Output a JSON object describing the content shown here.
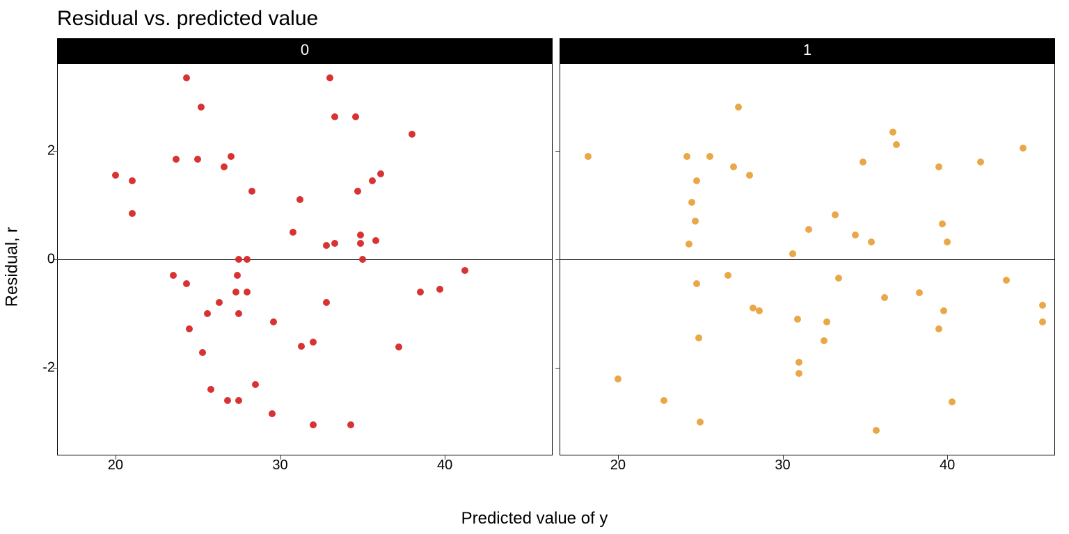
{
  "chart_data": {
    "type": "scatter",
    "title": "Residual vs. predicted value",
    "xlabel": "Predicted value of y",
    "ylabel": "Residual, r",
    "xlim": [
      16.5,
      46.5
    ],
    "ylim": [
      -3.6,
      3.6
    ],
    "x_ticks": [
      20,
      30,
      40
    ],
    "y_ticks": [
      -2,
      0,
      2
    ],
    "facets": [
      {
        "label": "0",
        "color": "#D62728",
        "reference_line": 0,
        "points": [
          {
            "x": 20.0,
            "y": 1.55
          },
          {
            "x": 21.0,
            "y": 1.45
          },
          {
            "x": 21.0,
            "y": 0.85
          },
          {
            "x": 23.5,
            "y": -0.3
          },
          {
            "x": 23.7,
            "y": 1.85
          },
          {
            "x": 24.3,
            "y": -0.45
          },
          {
            "x": 24.3,
            "y": 3.35
          },
          {
            "x": 24.5,
            "y": -1.28
          },
          {
            "x": 25.0,
            "y": 1.85
          },
          {
            "x": 25.3,
            "y": -1.72
          },
          {
            "x": 25.2,
            "y": 2.8
          },
          {
            "x": 25.6,
            "y": -1.0
          },
          {
            "x": 25.8,
            "y": -2.4
          },
          {
            "x": 26.3,
            "y": -0.8
          },
          {
            "x": 26.6,
            "y": 1.7
          },
          {
            "x": 26.8,
            "y": -2.6
          },
          {
            "x": 27.0,
            "y": 1.9
          },
          {
            "x": 27.3,
            "y": -0.6
          },
          {
            "x": 27.4,
            "y": -0.3
          },
          {
            "x": 27.5,
            "y": 0.0
          },
          {
            "x": 27.5,
            "y": -1.0
          },
          {
            "x": 27.5,
            "y": -2.6
          },
          {
            "x": 28.0,
            "y": 0.0
          },
          {
            "x": 28.0,
            "y": -0.6
          },
          {
            "x": 28.3,
            "y": 1.25
          },
          {
            "x": 28.5,
            "y": -2.3
          },
          {
            "x": 29.5,
            "y": -2.85
          },
          {
            "x": 29.6,
            "y": -1.15
          },
          {
            "x": 30.8,
            "y": 0.5
          },
          {
            "x": 31.2,
            "y": 1.1
          },
          {
            "x": 31.3,
            "y": -1.6
          },
          {
            "x": 32.0,
            "y": -1.52
          },
          {
            "x": 32.0,
            "y": -3.05
          },
          {
            "x": 32.8,
            "y": 0.25
          },
          {
            "x": 32.8,
            "y": -0.8
          },
          {
            "x": 33.0,
            "y": 3.35
          },
          {
            "x": 33.3,
            "y": 2.62
          },
          {
            "x": 33.3,
            "y": 0.3
          },
          {
            "x": 34.3,
            "y": -3.05
          },
          {
            "x": 34.6,
            "y": 2.62
          },
          {
            "x": 34.7,
            "y": 1.25
          },
          {
            "x": 34.9,
            "y": 0.45
          },
          {
            "x": 34.9,
            "y": 0.3
          },
          {
            "x": 35.0,
            "y": 0.0
          },
          {
            "x": 35.6,
            "y": 1.45
          },
          {
            "x": 35.8,
            "y": 0.35
          },
          {
            "x": 36.1,
            "y": 1.58
          },
          {
            "x": 37.2,
            "y": -1.62
          },
          {
            "x": 38.0,
            "y": 2.3
          },
          {
            "x": 38.5,
            "y": -0.6
          },
          {
            "x": 39.7,
            "y": -0.55
          },
          {
            "x": 41.2,
            "y": -0.2
          }
        ]
      },
      {
        "label": "1",
        "color": "#E8A23D",
        "reference_line": 0,
        "points": [
          {
            "x": 18.2,
            "y": 1.9
          },
          {
            "x": 20.0,
            "y": -2.2
          },
          {
            "x": 22.8,
            "y": -2.6
          },
          {
            "x": 24.2,
            "y": 1.9
          },
          {
            "x": 24.3,
            "y": 0.28
          },
          {
            "x": 24.5,
            "y": 1.05
          },
          {
            "x": 24.7,
            "y": 0.7
          },
          {
            "x": 24.8,
            "y": 1.45
          },
          {
            "x": 24.8,
            "y": -0.45
          },
          {
            "x": 24.9,
            "y": -1.45
          },
          {
            "x": 25.0,
            "y": -3.0
          },
          {
            "x": 25.6,
            "y": 1.9
          },
          {
            "x": 26.7,
            "y": -0.3
          },
          {
            "x": 27.0,
            "y": 1.7
          },
          {
            "x": 27.3,
            "y": 2.8
          },
          {
            "x": 28.0,
            "y": 1.55
          },
          {
            "x": 28.2,
            "y": -0.9
          },
          {
            "x": 28.6,
            "y": -0.95
          },
          {
            "x": 30.6,
            "y": 0.1
          },
          {
            "x": 30.9,
            "y": -1.1
          },
          {
            "x": 31.0,
            "y": -1.9
          },
          {
            "x": 31.0,
            "y": -2.1
          },
          {
            "x": 31.6,
            "y": 0.55
          },
          {
            "x": 32.5,
            "y": -1.5
          },
          {
            "x": 32.7,
            "y": -1.15
          },
          {
            "x": 33.2,
            "y": 0.82
          },
          {
            "x": 33.4,
            "y": -0.35
          },
          {
            "x": 34.4,
            "y": 0.45
          },
          {
            "x": 34.9,
            "y": 1.8
          },
          {
            "x": 35.4,
            "y": 0.32
          },
          {
            "x": 35.7,
            "y": -3.15
          },
          {
            "x": 36.2,
            "y": -0.7
          },
          {
            "x": 36.7,
            "y": 2.35
          },
          {
            "x": 36.9,
            "y": 2.12
          },
          {
            "x": 38.3,
            "y": -0.62
          },
          {
            "x": 39.5,
            "y": 1.7
          },
          {
            "x": 39.5,
            "y": -1.28
          },
          {
            "x": 39.7,
            "y": 0.65
          },
          {
            "x": 39.8,
            "y": -0.95
          },
          {
            "x": 40.0,
            "y": 0.32
          },
          {
            "x": 40.3,
            "y": -2.62
          },
          {
            "x": 42.0,
            "y": 1.8
          },
          {
            "x": 43.6,
            "y": -0.38
          },
          {
            "x": 44.6,
            "y": 2.05
          },
          {
            "x": 45.8,
            "y": -0.85
          },
          {
            "x": 45.8,
            "y": -1.15
          }
        ]
      }
    ]
  }
}
